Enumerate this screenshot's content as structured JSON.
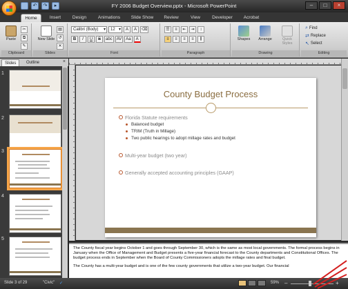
{
  "window": {
    "title": "FY 2006 Budget Overview.pptx - Microsoft PowerPoint",
    "controls": [
      "–",
      "□",
      "×"
    ]
  },
  "quick_access": [
    "save-icon",
    "undo-icon",
    "redo-icon",
    "slideshow-icon"
  ],
  "ribbon_tabs": [
    "Home",
    "Insert",
    "Design",
    "Animations",
    "Slide Show",
    "Review",
    "View",
    "Developer",
    "Acrobat"
  ],
  "ribbon": {
    "clipboard": {
      "label": "Clipboard",
      "paste": "Paste"
    },
    "slides": {
      "label": "Slides",
      "new_slide": "New Slide"
    },
    "font": {
      "label": "Font",
      "font_name": "Calibri (Body)",
      "font_size": "12",
      "grow": "A",
      "shrink": "A",
      "bold": "B",
      "italic": "I",
      "underline": "U",
      "strike": "S",
      "shadow": "abc",
      "spacing": "AV",
      "case": "Aa",
      "color": "A"
    },
    "paragraph": {
      "label": "Paragraph"
    },
    "drawing": {
      "label": "Drawing",
      "shapes": "Shapes",
      "arrange": "Arrange",
      "quick_styles": "Quick Styles"
    },
    "editing": {
      "label": "Editing",
      "find": "Find",
      "replace": "Replace",
      "select": "Select"
    }
  },
  "slide_panel": {
    "tabs": [
      "Slides",
      "Outline"
    ],
    "close": "×",
    "thumbnail_numbers": [
      "1",
      "2",
      "3",
      "4",
      "5"
    ],
    "selected_index": 3
  },
  "slide": {
    "title": "County Budget Process",
    "bullets": [
      {
        "text": "Florida Statute requirements",
        "sub": [
          "Balanced budget",
          "TRIM (Truth in Millage)",
          "Two public hearings to adopt millage rates and budget"
        ]
      },
      {
        "text": "Multi-year budget (two year)",
        "sub": []
      },
      {
        "text": "Generally accepted accounting principles (GAAP)",
        "sub": []
      }
    ],
    "colors": {
      "title": "#8a6d40",
      "accent": "#b89a68",
      "bullet": "#b8552b",
      "footer": "#8a7550"
    }
  },
  "notes": {
    "p1": "The County fiscal year begins October 1 and goes through September 30, which is the same as most local governments. The formal process begins in January when the Office of Management and Budget presents a five-year financial forecast to the County departments and Constitutional Offices. The budget process ends in September when the Board of County Commissioners adopts the millage rates and final budget.",
    "p2": "The County has a multi-year budget and is one of the few county governments that utilize a two-year budget. Our financial"
  },
  "status": {
    "slide_of": "Slide 3 of 29",
    "theme": "\"Civic\"",
    "zoom": "59%",
    "zoom_level": 0.45,
    "minus": "–",
    "plus": "+"
  },
  "colors": {
    "selected_thumb": "#f7a64a",
    "annotation": "#d42020"
  }
}
